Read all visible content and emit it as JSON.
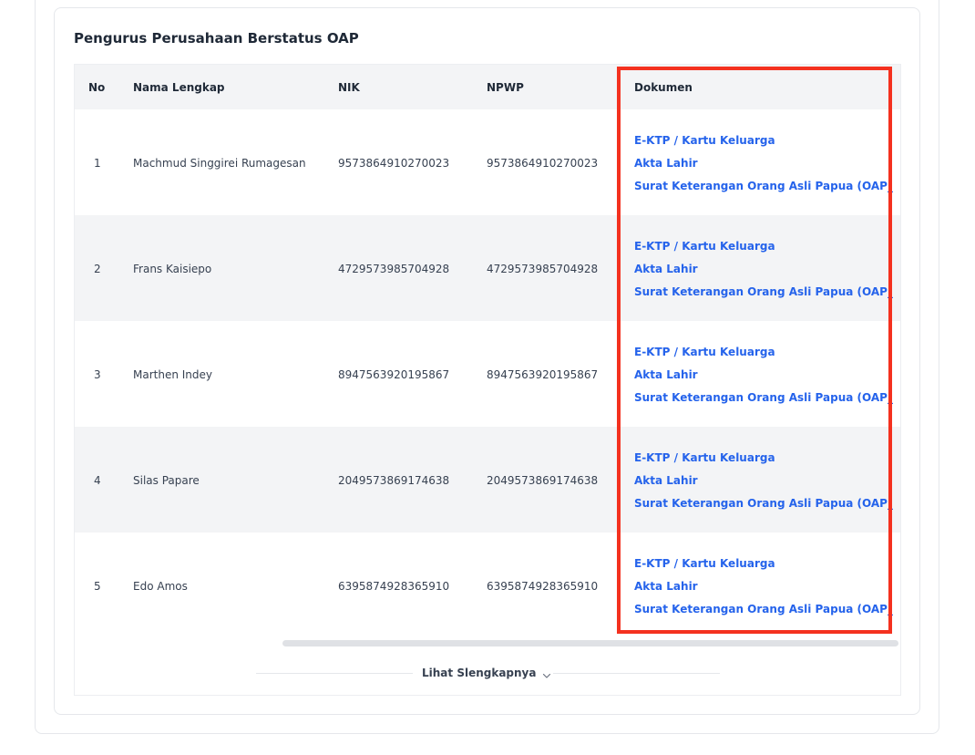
{
  "section": {
    "title": "Pengurus Perusahaan Berstatus OAP"
  },
  "table": {
    "headers": {
      "no": "No",
      "name": "Nama Lengkap",
      "nik": "NIK",
      "npwp": "NPWP",
      "docs": "Dokumen"
    },
    "rows": [
      {
        "no": "1",
        "name": "Machmud Singgirei Rumagesan",
        "nik": "9573864910270023",
        "npwp": "9573864910270023",
        "docs": [
          "E-KTP / Kartu Keluarga",
          "Akta Lahir",
          "Surat Keterangan Orang Asli Papua (OAP_"
        ]
      },
      {
        "no": "2",
        "name": "Frans Kaisiepo",
        "nik": "4729573985704928",
        "npwp": "4729573985704928",
        "docs": [
          "E-KTP / Kartu Keluarga",
          "Akta Lahir",
          "Surat Keterangan Orang Asli Papua (OAP_"
        ]
      },
      {
        "no": "3",
        "name": "Marthen Indey",
        "nik": "8947563920195867",
        "npwp": "8947563920195867",
        "docs": [
          "E-KTP / Kartu Keluarga",
          "Akta Lahir",
          "Surat Keterangan Orang Asli Papua (OAP_"
        ]
      },
      {
        "no": "4",
        "name": "Silas Papare",
        "nik": "2049573869174638",
        "npwp": "2049573869174638",
        "docs": [
          "E-KTP / Kartu Keluarga",
          "Akta Lahir",
          "Surat Keterangan Orang Asli Papua (OAP_"
        ]
      },
      {
        "no": "5",
        "name": "Edo Amos",
        "nik": "6395874928365910",
        "npwp": "6395874928365910",
        "docs": [
          "E-KTP / Kartu Keluarga",
          "Akta Lahir",
          "Surat Keterangan Orang Asli Papua (OAP_"
        ]
      }
    ]
  },
  "footer": {
    "more_label": "Lihat Slengkapnya",
    "more_icon": "chevron-down-icon"
  },
  "colors": {
    "link": "#2563eb",
    "header_bg": "#f3f4f6",
    "highlight": "#f4311f"
  }
}
